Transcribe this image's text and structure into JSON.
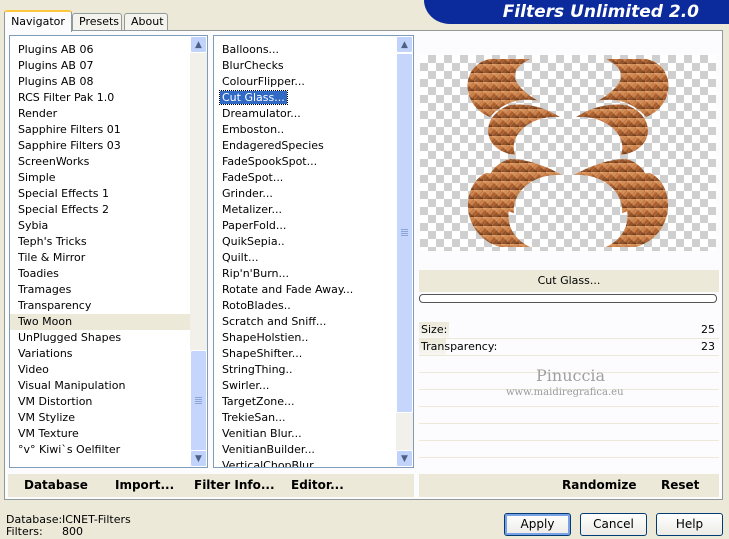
{
  "window": {
    "title": "Filters Unlimited 2.0"
  },
  "tabs": [
    {
      "label": "Navigator",
      "active": true
    },
    {
      "label": "Presets",
      "active": false
    },
    {
      "label": "About",
      "active": false
    }
  ],
  "categories": {
    "items": [
      "Plugins AB 06",
      "Plugins AB 07",
      "Plugins AB 08",
      "RCS Filter Pak 1.0",
      "Render",
      "Sapphire Filters 01",
      "Sapphire Filters 03",
      "ScreenWorks",
      "Simple",
      "Special Effects 1",
      "Special Effects 2",
      "Sybia",
      "Teph's Tricks",
      "Tile & Mirror",
      "Toadies",
      "Tramages",
      "Transparency",
      "Two Moon",
      "UnPlugged Shapes",
      "Variations",
      "Video",
      "Visual Manipulation",
      "VM Distortion",
      "VM Stylize",
      "VM Texture",
      "°v° Kiwi`s Oelfilter"
    ],
    "selected": "Two Moon"
  },
  "filters": {
    "items": [
      "Balloons...",
      "BlurChecks",
      "ColourFlipper...",
      "Cut Glass...",
      "Dreamulator...",
      "Emboston..",
      "EndageredSpecies",
      "FadeSpookSpot...",
      "FadeSpot...",
      "Grinder...",
      "Metalizer...",
      "PaperFold...",
      "QuikSepia..",
      "Quilt...",
      "Rip'n'Burn...",
      "Rotate and Fade Away...",
      "RotoBlades..",
      "Scratch and Sniff...",
      "ShapeHolstien..",
      "ShapeShifter...",
      "StringThing..",
      "Swirler...",
      "TargetZone...",
      "TrekieSan...",
      "Venitian Blur...",
      "VenitianBuilder...",
      "VerticalChopBlur..."
    ],
    "selected": "Cut Glass..."
  },
  "preview": {
    "filter_name": "Cut Glass...",
    "progress": 0
  },
  "parameters": [
    {
      "label": "Size:",
      "value": "25",
      "fraction": 0.1
    },
    {
      "label": "Transparency:",
      "value": "23",
      "fraction": 0.09
    }
  ],
  "watermark": {
    "name": "Pinuccia",
    "site": "www.maidiregrafica.eu"
  },
  "toolbar_left": {
    "database": "Database",
    "import": "Import...",
    "filter_info": "Filter Info...",
    "editor": "Editor..."
  },
  "toolbar_right": {
    "randomize": "Randomize",
    "reset": "Reset"
  },
  "status": {
    "database_label": "Database:",
    "database_value": "ICNET-Filters",
    "filters_label": "Filters:",
    "filters_value": "800"
  },
  "buttons": {
    "apply": "Apply",
    "cancel": "Cancel",
    "help": "Help"
  },
  "colors": {
    "banner": "#0b2a9c",
    "selection": "#316ac5",
    "background": "#ece9d8"
  }
}
